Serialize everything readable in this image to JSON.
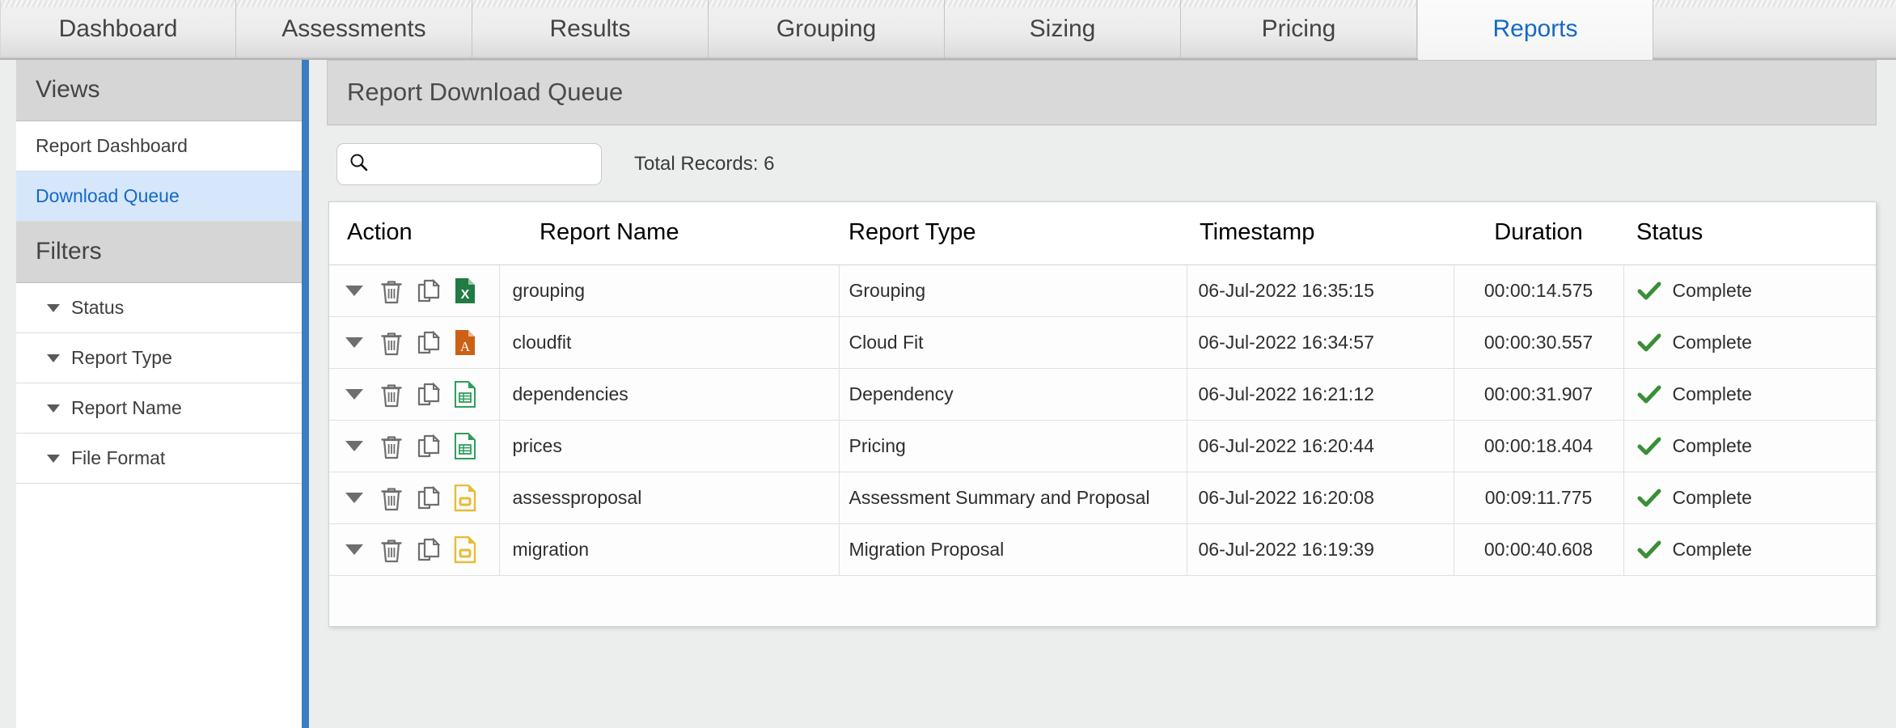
{
  "tabs": [
    {
      "label": "Dashboard",
      "active": false
    },
    {
      "label": "Assessments",
      "active": false
    },
    {
      "label": "Results",
      "active": false
    },
    {
      "label": "Grouping",
      "active": false
    },
    {
      "label": "Sizing",
      "active": false
    },
    {
      "label": "Pricing",
      "active": false
    },
    {
      "label": "Reports",
      "active": true
    }
  ],
  "sidebar": {
    "views_header": "Views",
    "views": [
      {
        "label": "Report Dashboard",
        "selected": false
      },
      {
        "label": "Download Queue",
        "selected": true
      }
    ],
    "filters_header": "Filters",
    "filters": [
      {
        "label": "Status"
      },
      {
        "label": "Report Type"
      },
      {
        "label": "Report Name"
      },
      {
        "label": "File Format"
      }
    ]
  },
  "main": {
    "panel_title": "Report Download Queue",
    "search": {
      "value": "",
      "placeholder": "",
      "icon": "search-icon"
    },
    "total_records_label": "Total Records: 6",
    "table": {
      "columns": [
        "Action",
        "Report Name",
        "Report Type",
        "Timestamp",
        "Duration",
        "Status"
      ],
      "rows": [
        {
          "actions": [
            "expand-caret-icon",
            "delete-icon",
            "copy-icon",
            "excel-file-icon"
          ],
          "file_format": "excel",
          "report_name": "grouping",
          "report_type": "Grouping",
          "timestamp": "06-Jul-2022 16:35:15",
          "duration": "00:00:14.575",
          "status": "Complete"
        },
        {
          "actions": [
            "expand-caret-icon",
            "delete-icon",
            "copy-icon",
            "pdf-file-icon"
          ],
          "file_format": "pdf",
          "report_name": "cloudfit",
          "report_type": "Cloud Fit",
          "timestamp": "06-Jul-2022 16:34:57",
          "duration": "00:00:30.557",
          "status": "Complete"
        },
        {
          "actions": [
            "expand-caret-icon",
            "delete-icon",
            "copy-icon",
            "csv-file-icon"
          ],
          "file_format": "csv",
          "report_name": "dependencies",
          "report_type": "Dependency",
          "timestamp": "06-Jul-2022 16:21:12",
          "duration": "00:00:31.907",
          "status": "Complete"
        },
        {
          "actions": [
            "expand-caret-icon",
            "delete-icon",
            "copy-icon",
            "csv-file-icon"
          ],
          "file_format": "csv",
          "report_name": "prices",
          "report_type": "Pricing",
          "timestamp": "06-Jul-2022 16:20:44",
          "duration": "00:00:18.404",
          "status": "Complete"
        },
        {
          "actions": [
            "expand-caret-icon",
            "delete-icon",
            "copy-icon",
            "powerpoint-file-icon"
          ],
          "file_format": "powerpoint",
          "report_name": "assessproposal",
          "report_type": "Assessment Summary and Proposal",
          "timestamp": "06-Jul-2022 16:20:08",
          "duration": "00:09:11.775",
          "status": "Complete"
        },
        {
          "actions": [
            "expand-caret-icon",
            "delete-icon",
            "copy-icon",
            "powerpoint-file-icon"
          ],
          "file_format": "powerpoint",
          "report_name": "migration",
          "report_type": "Migration Proposal",
          "timestamp": "06-Jul-2022 16:19:39",
          "duration": "00:00:40.608",
          "status": "Complete"
        }
      ]
    }
  },
  "colors": {
    "accent_blue": "#1569c7",
    "sidebar_divider_blue": "#3a7dc0",
    "selected_row_blue": "#d6e7fb",
    "status_green": "#3a8f36",
    "excel_green": "#217b42",
    "pdf_orange": "#cc6116",
    "csv_green": "#2e9e5b",
    "powerpoint_yellow": "#e8bb38",
    "icon_grey": "#6e6e6e"
  }
}
